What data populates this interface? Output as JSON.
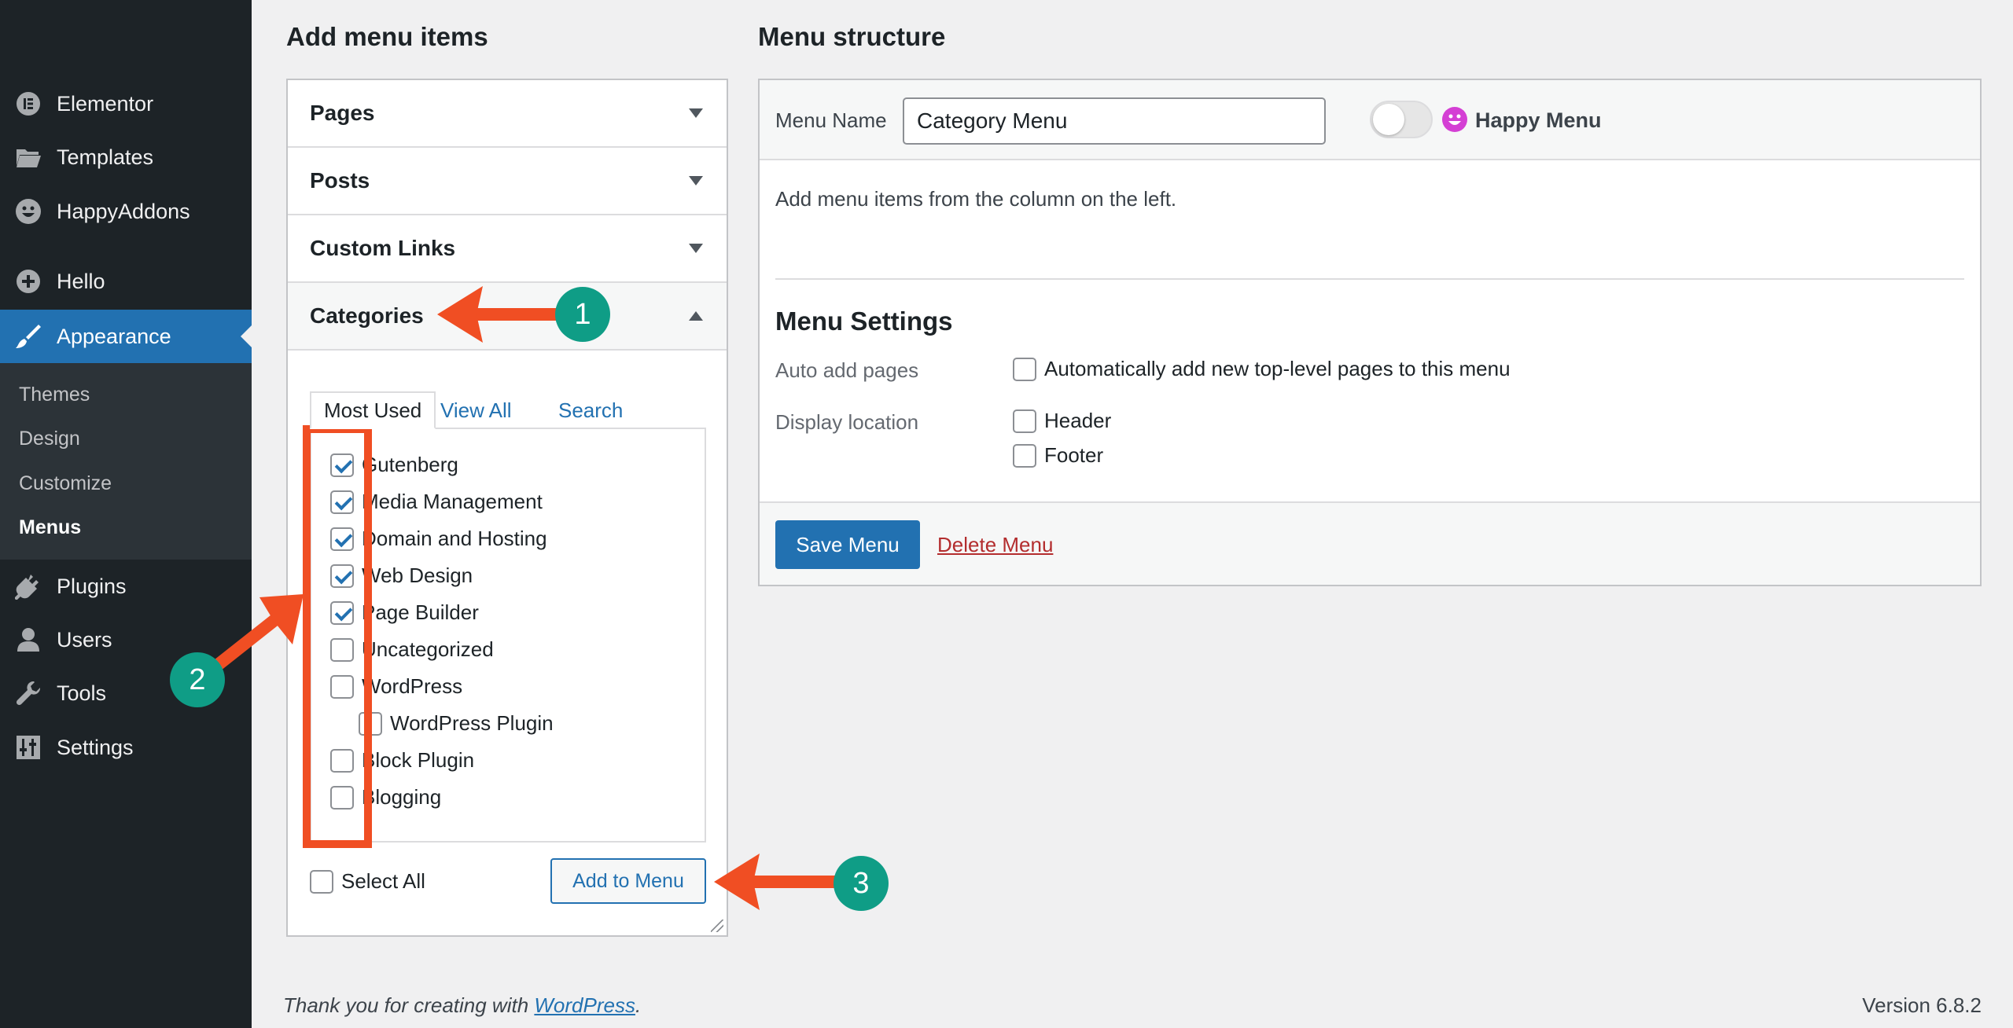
{
  "sidebar": {
    "items": [
      {
        "label": "Elementor",
        "icon": "elementor-icon"
      },
      {
        "label": "Templates",
        "icon": "folder-icon"
      },
      {
        "label": "HappyAddons",
        "icon": "happyaddons-icon"
      },
      {
        "label": "Hello",
        "icon": "plus-circle-icon"
      },
      {
        "label": "Appearance",
        "icon": "paintbrush-icon"
      },
      {
        "label": "Plugins",
        "icon": "plug-icon"
      },
      {
        "label": "Users",
        "icon": "user-icon"
      },
      {
        "label": "Tools",
        "icon": "wrench-icon"
      },
      {
        "label": "Settings",
        "icon": "sliders-icon"
      }
    ],
    "submenu": [
      "Themes",
      "Design",
      "Customize",
      "Menus"
    ],
    "active_color": "#2271b1"
  },
  "left": {
    "heading": "Add menu items",
    "sections": [
      "Pages",
      "Posts",
      "Custom Links",
      "Categories"
    ],
    "tabs": [
      "Most Used",
      "View All",
      "Search"
    ],
    "categories": [
      {
        "label": "Gutenberg",
        "checked": true
      },
      {
        "label": "Media Management",
        "checked": true
      },
      {
        "label": "Domain and Hosting",
        "checked": true
      },
      {
        "label": "Web Design",
        "checked": true
      },
      {
        "label": "Page Builder",
        "checked": true
      },
      {
        "label": "Uncategorized",
        "checked": false
      },
      {
        "label": "WordPress",
        "checked": false
      },
      {
        "label": "WordPress Plugin",
        "checked": false
      },
      {
        "label": "Block Plugin",
        "checked": false
      },
      {
        "label": "Blogging",
        "checked": false
      }
    ],
    "select_all": "Select All",
    "add_button": "Add to Menu"
  },
  "right": {
    "heading": "Menu structure",
    "menu_name_label": "Menu Name",
    "menu_name_value": "Category Menu",
    "happy_menu_label": "Happy Menu",
    "hint": "Add menu items from the column on the left.",
    "settings_title": "Menu Settings",
    "auto_add_label": "Auto add pages",
    "auto_add_option": "Automatically add new top-level pages to this menu",
    "display_location_label": "Display location",
    "locations": [
      "Header",
      "Footer"
    ],
    "save_button": "Save Menu",
    "delete_link": "Delete Menu"
  },
  "footer": {
    "thanks_prefix": "Thank you for creating with ",
    "thanks_link": "WordPress",
    "thanks_suffix": ".",
    "version": "Version 6.8.2"
  },
  "annotations": {
    "badges": [
      "1",
      "2",
      "3"
    ],
    "arrow_color": "#f04e23",
    "badge_color": "#0f9d86"
  }
}
